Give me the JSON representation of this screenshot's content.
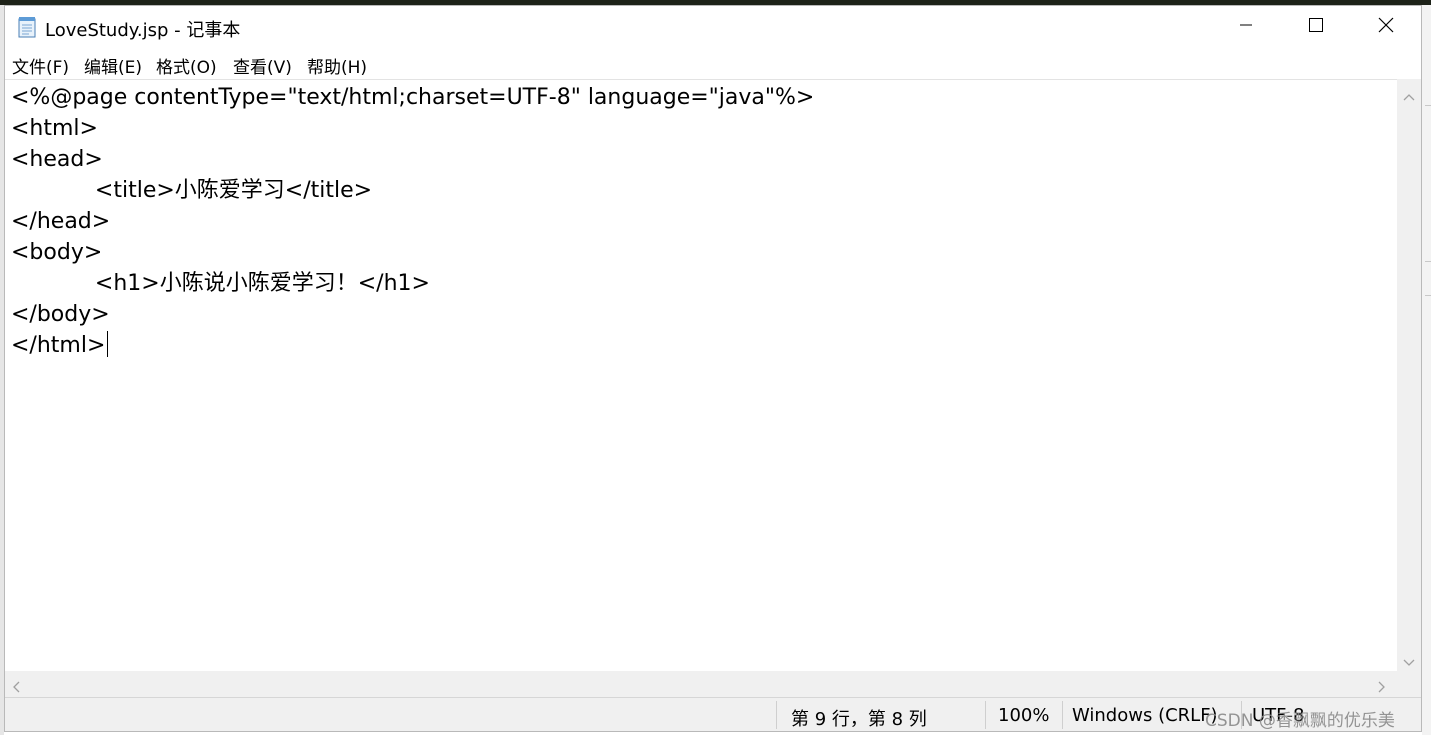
{
  "window": {
    "title": "LoveStudy.jsp - 记事本",
    "icon": "notepad-icon",
    "controls": [
      "minimize-icon",
      "maximize-icon",
      "close-icon"
    ]
  },
  "menu": [
    {
      "label": "文件(F)"
    },
    {
      "label": "编辑(E)"
    },
    {
      "label": "格式(O)"
    },
    {
      "label": "查看(V)"
    },
    {
      "label": "帮助(H)"
    }
  ],
  "editor": {
    "lines": [
      "<%@page contentType=\"text/html;charset=UTF-8\" language=\"java\"%>",
      "<html>",
      "<head>",
      "            <title>小陈爱学习</title>",
      "</head>",
      "<body>",
      "            <h1>小陈说小陈爱学习！</h1>",
      "</body>",
      "</html>"
    ]
  },
  "status": {
    "position": "第 9 行，第 8 列",
    "zoom": "100%",
    "line_ending": "Windows (CRLF)",
    "encoding": "UTF-8"
  },
  "watermark": "CSDN @香飘飘的优乐美"
}
